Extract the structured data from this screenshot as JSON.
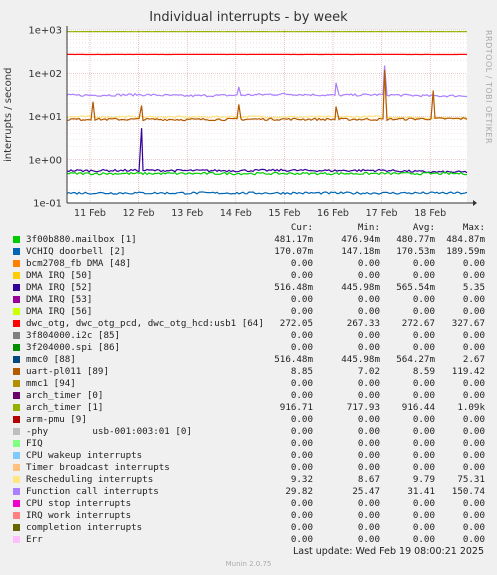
{
  "title": "Individual interrupts - by week",
  "side_label": "RRDTOOL / TOBI OETIKER",
  "footer": {
    "last_update": "Last update: Wed Feb 19 08:00:21 2025",
    "version": "Munin 2.0.75"
  },
  "legend_header": {
    "cur": "Cur:",
    "min": "Min:",
    "avg": "Avg:",
    "max": "Max:"
  },
  "legend": [
    {
      "name": "3f00b880.mailbox [1]",
      "color": "#00cc00",
      "cur": "481.17m",
      "min": "476.94m",
      "avg": "480.77m",
      "max": "484.87m"
    },
    {
      "name": "VCHIQ doorbell [2]",
      "color": "#0066b3",
      "cur": "170.07m",
      "min": "147.18m",
      "avg": "170.53m",
      "max": "189.59m"
    },
    {
      "name": "bcm2708_fb DMA [48]",
      "color": "#ff8000",
      "cur": "0.00",
      "min": "0.00",
      "avg": "0.00",
      "max": "0.00"
    },
    {
      "name": "DMA IRQ [50]",
      "color": "#ffcc00",
      "cur": "0.00",
      "min": "0.00",
      "avg": "0.00",
      "max": "0.00"
    },
    {
      "name": "DMA IRQ [52]",
      "color": "#330099",
      "cur": "516.48m",
      "min": "445.98m",
      "avg": "565.54m",
      "max": "5.35"
    },
    {
      "name": "DMA IRQ [53]",
      "color": "#990099",
      "cur": "0.00",
      "min": "0.00",
      "avg": "0.00",
      "max": "0.00"
    },
    {
      "name": "DMA IRQ [56]",
      "color": "#ccff00",
      "cur": "0.00",
      "min": "0.00",
      "avg": "0.00",
      "max": "0.00"
    },
    {
      "name": "dwc_otg, dwc_otg_pcd, dwc_otg_hcd:usb1 [64]",
      "color": "#ff0000",
      "cur": "272.05",
      "min": "267.33",
      "avg": "272.67",
      "max": "327.67"
    },
    {
      "name": "3f804000.i2c [85]",
      "color": "#808080",
      "cur": "0.00",
      "min": "0.00",
      "avg": "0.00",
      "max": "0.00"
    },
    {
      "name": "3f204000.spi [86]",
      "color": "#008f00",
      "cur": "0.00",
      "min": "0.00",
      "avg": "0.00",
      "max": "0.00"
    },
    {
      "name": "mmc0 [88]",
      "color": "#00487d",
      "cur": "516.48m",
      "min": "445.98m",
      "avg": "564.27m",
      "max": "2.67"
    },
    {
      "name": "uart-pl011 [89]",
      "color": "#b35a00",
      "cur": "8.85",
      "min": "7.02",
      "avg": "8.59",
      "max": "119.42"
    },
    {
      "name": "mmc1 [94]",
      "color": "#b38f00",
      "cur": "0.00",
      "min": "0.00",
      "avg": "0.00",
      "max": "0.00"
    },
    {
      "name": "arch_timer [0]",
      "color": "#6b006b",
      "cur": "0.00",
      "min": "0.00",
      "avg": "0.00",
      "max": "0.00"
    },
    {
      "name": "arch_timer [1]",
      "color": "#8fb300",
      "cur": "916.71",
      "min": "717.93",
      "avg": "916.44",
      "max": "1.09k"
    },
    {
      "name": "arm-pmu [9]",
      "color": "#b30000",
      "cur": "0.00",
      "min": "0.00",
      "avg": "0.00",
      "max": "0.00"
    },
    {
      "name": "-phy        usb-001:003:01 [0]",
      "color": "#bebebe",
      "cur": "0.00",
      "min": "0.00",
      "avg": "0.00",
      "max": "0.00"
    },
    {
      "name": "FIQ",
      "color": "#80ff80",
      "cur": "0.00",
      "min": "0.00",
      "avg": "0.00",
      "max": "0.00"
    },
    {
      "name": "CPU wakeup interrupts",
      "color": "#80c9ff",
      "cur": "0.00",
      "min": "0.00",
      "avg": "0.00",
      "max": "0.00"
    },
    {
      "name": "Timer broadcast interrupts",
      "color": "#ffc080",
      "cur": "0.00",
      "min": "0.00",
      "avg": "0.00",
      "max": "0.00"
    },
    {
      "name": "Rescheduling interrupts",
      "color": "#ffe680",
      "cur": "9.32",
      "min": "8.67",
      "avg": "9.79",
      "max": "75.31"
    },
    {
      "name": "Function call interrupts",
      "color": "#aa80ff",
      "cur": "29.82",
      "min": "25.47",
      "avg": "31.41",
      "max": "150.74"
    },
    {
      "name": "CPU stop interrupts",
      "color": "#ee00cc",
      "cur": "0.00",
      "min": "0.00",
      "avg": "0.00",
      "max": "0.00"
    },
    {
      "name": "IRQ work interrupts",
      "color": "#ff8080",
      "cur": "0.00",
      "min": "0.00",
      "avg": "0.00",
      "max": "0.00"
    },
    {
      "name": "completion interrupts",
      "color": "#666600",
      "cur": "0.00",
      "min": "0.00",
      "avg": "0.00",
      "max": "0.00"
    },
    {
      "name": "Err",
      "color": "#ffbfff",
      "cur": "0.00",
      "min": "0.00",
      "avg": "0.00",
      "max": "0.00"
    }
  ],
  "chart_data": {
    "type": "line",
    "title": "Individual interrupts - by week",
    "ylabel": "interrupts / second",
    "yscale": "log",
    "ylim": [
      0.1,
      1000
    ],
    "yticks": [
      "1e-01",
      "1e+00",
      "1e+01",
      "1e+02",
      "1e+03"
    ],
    "xticks": [
      "11 Feb",
      "12 Feb",
      "13 Feb",
      "14 Feb",
      "15 Feb",
      "16 Feb",
      "17 Feb",
      "18 Feb"
    ],
    "grid": true,
    "series": [
      {
        "name": "arch_timer [1]",
        "color": "#8fb300",
        "values": [
          916.7,
          916.4,
          916.5,
          916.4,
          916.6,
          916.4,
          916.5,
          916.7
        ]
      },
      {
        "name": "dwc_otg, dwc_otg_pcd, dwc_otg_hcd:usb1 [64]",
        "color": "#ff0000",
        "values": [
          272.1,
          272.7,
          272.5,
          272.6,
          272.7,
          272.6,
          272.8,
          272.1
        ]
      },
      {
        "name": "Function call interrupts",
        "color": "#aa80ff",
        "values": [
          31,
          32,
          30,
          31,
          33,
          31,
          32,
          30
        ],
        "spikes": [
          {
            "x": "14 Feb",
            "value": 48
          },
          {
            "x": "16 Feb",
            "value": 60
          },
          {
            "x": "17 Feb",
            "value": 150.7
          }
        ]
      },
      {
        "name": "Rescheduling interrupts",
        "color": "#ffe680",
        "values": [
          9.8,
          9.8,
          9.7,
          9.9,
          9.8,
          9.7,
          9.9,
          9.3
        ],
        "spikes": [
          {
            "x": "17 Feb",
            "value": 75.3
          }
        ]
      },
      {
        "name": "uart-pl011 [89]",
        "color": "#b35a00",
        "values": [
          8.6,
          8.6,
          8.5,
          8.6,
          8.7,
          8.6,
          8.6,
          8.9
        ],
        "spikes": [
          {
            "x": "11 Feb",
            "value": 22
          },
          {
            "x": "12 Feb",
            "value": 18
          },
          {
            "x": "14 Feb",
            "value": 19
          },
          {
            "x": "16 Feb",
            "value": 17
          },
          {
            "x": "17 Feb",
            "value": 119.4
          },
          {
            "x": "18 Feb",
            "value": 40
          }
        ]
      },
      {
        "name": "DMA IRQ [52]",
        "color": "#330099",
        "values": [
          0.56,
          0.57,
          0.56,
          0.56,
          0.57,
          0.56,
          0.57,
          0.52
        ],
        "spikes": [
          {
            "x": "12 Feb",
            "value": 5.35
          }
        ]
      },
      {
        "name": "3f00b880.mailbox [1]",
        "color": "#00cc00",
        "values": [
          0.48,
          0.48,
          0.48,
          0.48,
          0.48,
          0.48,
          0.48,
          0.48
        ]
      },
      {
        "name": "VCHIQ doorbell [2]",
        "color": "#0066b3",
        "values": [
          0.17,
          0.17,
          0.17,
          0.17,
          0.17,
          0.17,
          0.17,
          0.17
        ]
      }
    ]
  }
}
